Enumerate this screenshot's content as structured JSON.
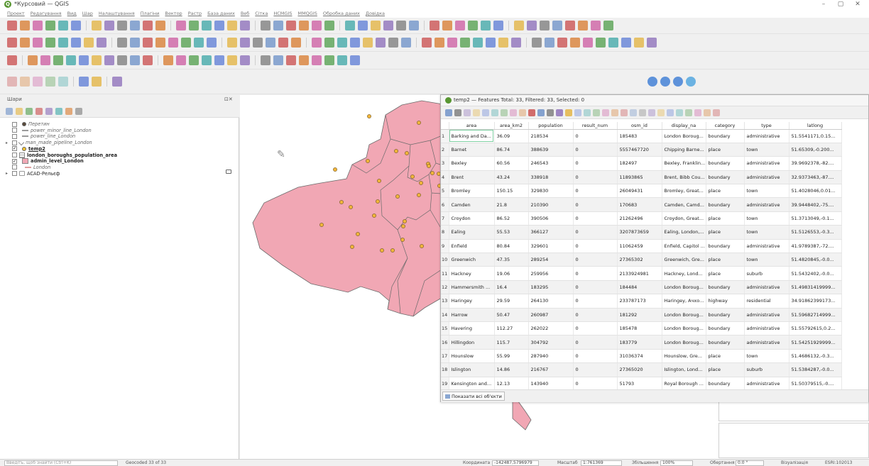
{
  "window": {
    "title": "*Курсовий — QGIS",
    "minimize": "–",
    "maximize": "▢",
    "close": "✕"
  },
  "menu": [
    "Проект",
    "Редагування",
    "Вид",
    "Шар",
    "Налаштування",
    "Плагіни",
    "Вектор",
    "Растр",
    "База даних",
    "Веб",
    "Сітка",
    "HCMGIS",
    "MMQGIS",
    "Обробка даних",
    "Довідка"
  ],
  "layers_panel": {
    "title": "Шари",
    "items": [
      {
        "label": "Перетин",
        "checked": false,
        "italic": true,
        "symbol": "dot",
        "color": "#5a4a3a",
        "indent": 1
      },
      {
        "label": "power_minor_line_London",
        "checked": false,
        "italic": true,
        "symbol": "line",
        "color": "#9b9b9b",
        "indent": 1
      },
      {
        "label": "power_line_London",
        "checked": false,
        "italic": true,
        "symbol": "line",
        "color": "#9b9b9b",
        "indent": 1
      },
      {
        "label": "man_made_pipeline_London",
        "checked": false,
        "italic": true,
        "symbol": "vline",
        "color": "#9b9b9b",
        "indent": 0,
        "expander": true
      },
      {
        "label": "temp2",
        "checked": true,
        "italic": false,
        "bold": true,
        "underline": true,
        "symbol": "dot",
        "color": "#f2c230",
        "indent": 1
      },
      {
        "label": "london_boroughs_population_area",
        "checked": false,
        "italic": false,
        "bold": true,
        "symbol": "table",
        "color": "#777",
        "indent": 0
      },
      {
        "label": "admin_level_London",
        "checked": true,
        "italic": false,
        "bold": true,
        "symbol": "box",
        "color": "#f1a7b4",
        "indent": 1
      },
      {
        "label": "London",
        "checked": false,
        "italic": true,
        "symbol": "dash",
        "color": "#e0a0a0",
        "indent": 2
      },
      {
        "label": "ACAD-Рельєф",
        "checked": false,
        "italic": false,
        "symbol": "group",
        "color": "#999",
        "indent": 0,
        "expander": true
      }
    ]
  },
  "attribute_table": {
    "title": "temp2 — Features Total: 33, Filtered: 33, Selected: 0",
    "columns": [
      "area",
      "area_km2",
      "population",
      "result_num",
      "osm_id",
      "display_na",
      "category",
      "type",
      "latlong"
    ],
    "rows": [
      [
        "1",
        "Barking and Da...",
        "36.09",
        "218534",
        "0",
        "185483",
        "London Boroug...",
        "boundary",
        "administrative",
        "51.5541171,0.15..."
      ],
      [
        "2",
        "Barnet",
        "86.74",
        "388639",
        "0",
        "5557467720",
        "Chipping Barne...",
        "place",
        "town",
        "51.65309,-0.200..."
      ],
      [
        "3",
        "Bexley",
        "60.56",
        "246543",
        "0",
        "182497",
        "Bexley, Franklin...",
        "boundary",
        "administrative",
        "39.9692378,-82...."
      ],
      [
        "4",
        "Brent",
        "43.24",
        "338918",
        "0",
        "11893865",
        "Brent, Bibb Cou...",
        "boundary",
        "administrative",
        "32.9373463,-87...."
      ],
      [
        "5",
        "Bromley",
        "150.15",
        "329830",
        "0",
        "26049431",
        "Bromley, Great...",
        "place",
        "town",
        "51.4028046,0.01..."
      ],
      [
        "6",
        "Camden",
        "21.8",
        "210390",
        "0",
        "170683",
        "Camden, Camd...",
        "boundary",
        "administrative",
        "39.9448402,-75...."
      ],
      [
        "7",
        "Croydon",
        "86.52",
        "390506",
        "0",
        "21262496",
        "Croydon, Great...",
        "place",
        "town",
        "51.3713049,-0.1..."
      ],
      [
        "8",
        "Ealing",
        "55.53",
        "366127",
        "0",
        "3207873659",
        "Ealing, London,...",
        "place",
        "town",
        "51.5126553,-0.3..."
      ],
      [
        "9",
        "Enfield",
        "80.84",
        "329601",
        "0",
        "11062459",
        "Enfield, Capitol ...",
        "boundary",
        "administrative",
        "41.9789387,-72...."
      ],
      [
        "10",
        "Greenwich",
        "47.35",
        "289254",
        "0",
        "27365302",
        "Greenwich, Gre...",
        "place",
        "town",
        "51.4820845,-0.0..."
      ],
      [
        "11",
        "Hackney",
        "19.06",
        "259956",
        "0",
        "2133924981",
        "Hackney, Lond...",
        "place",
        "suburb",
        "51.5432402,-0.0..."
      ],
      [
        "12",
        "Hammersmith ...",
        "16.4",
        "183295",
        "0",
        "184484",
        "London Boroug...",
        "boundary",
        "administrative",
        "51.49831419999..."
      ],
      [
        "13",
        "Haringey",
        "29.59",
        "264130",
        "0",
        "233787173",
        "Haringey, Ачхо...",
        "highway",
        "residential",
        "34.91862399173..."
      ],
      [
        "14",
        "Harrow",
        "50.47",
        "260987",
        "0",
        "181292",
        "London Boroug...",
        "boundary",
        "administrative",
        "51.59682714999..."
      ],
      [
        "15",
        "Havering",
        "112.27",
        "262022",
        "0",
        "185478",
        "London Boroug...",
        "boundary",
        "administrative",
        "51.55792615,0.2..."
      ],
      [
        "16",
        "Hillingdon",
        "115.7",
        "304792",
        "0",
        "183779",
        "London Boroug...",
        "boundary",
        "administrative",
        "51.54251929999..."
      ],
      [
        "17",
        "Hounslow",
        "55.99",
        "287940",
        "0",
        "31036374",
        "Hounslow, Gre...",
        "place",
        "town",
        "51.4686132,-0.3..."
      ],
      [
        "18",
        "Islington",
        "14.86",
        "216767",
        "0",
        "27365020",
        "Islington, Lond...",
        "place",
        "suburb",
        "51.5384287,-0.0..."
      ],
      [
        "19",
        "Kensington and...",
        "12.13",
        "143940",
        "0",
        "51793",
        "Royal Borough ...",
        "boundary",
        "administrative",
        "51.50379515,-0...."
      ]
    ],
    "show_all_button": "Показати всі об'єкти"
  },
  "status": {
    "search_placeholder": "Введіть, щоб знайти (Ctrl+K)",
    "geocoded": "Geocoded 33 of 33",
    "coord_label": "Координата",
    "coord_value": "-142487,5796979",
    "scale_label": "Масштаб",
    "scale_value": "1:761369",
    "magnifier_label": "Збільшення",
    "magnifier_value": "100%",
    "rotation_label": "Обертання",
    "rotation_value": "0.0 °",
    "render_label": "Візуалізація",
    "crs": "ESRI:102013"
  },
  "colors": {
    "polygon_fill": "#f1a7b4",
    "polygon_stroke": "#6b6b6b",
    "point_fill": "#f2b53a",
    "qgis_green": "#589632"
  }
}
